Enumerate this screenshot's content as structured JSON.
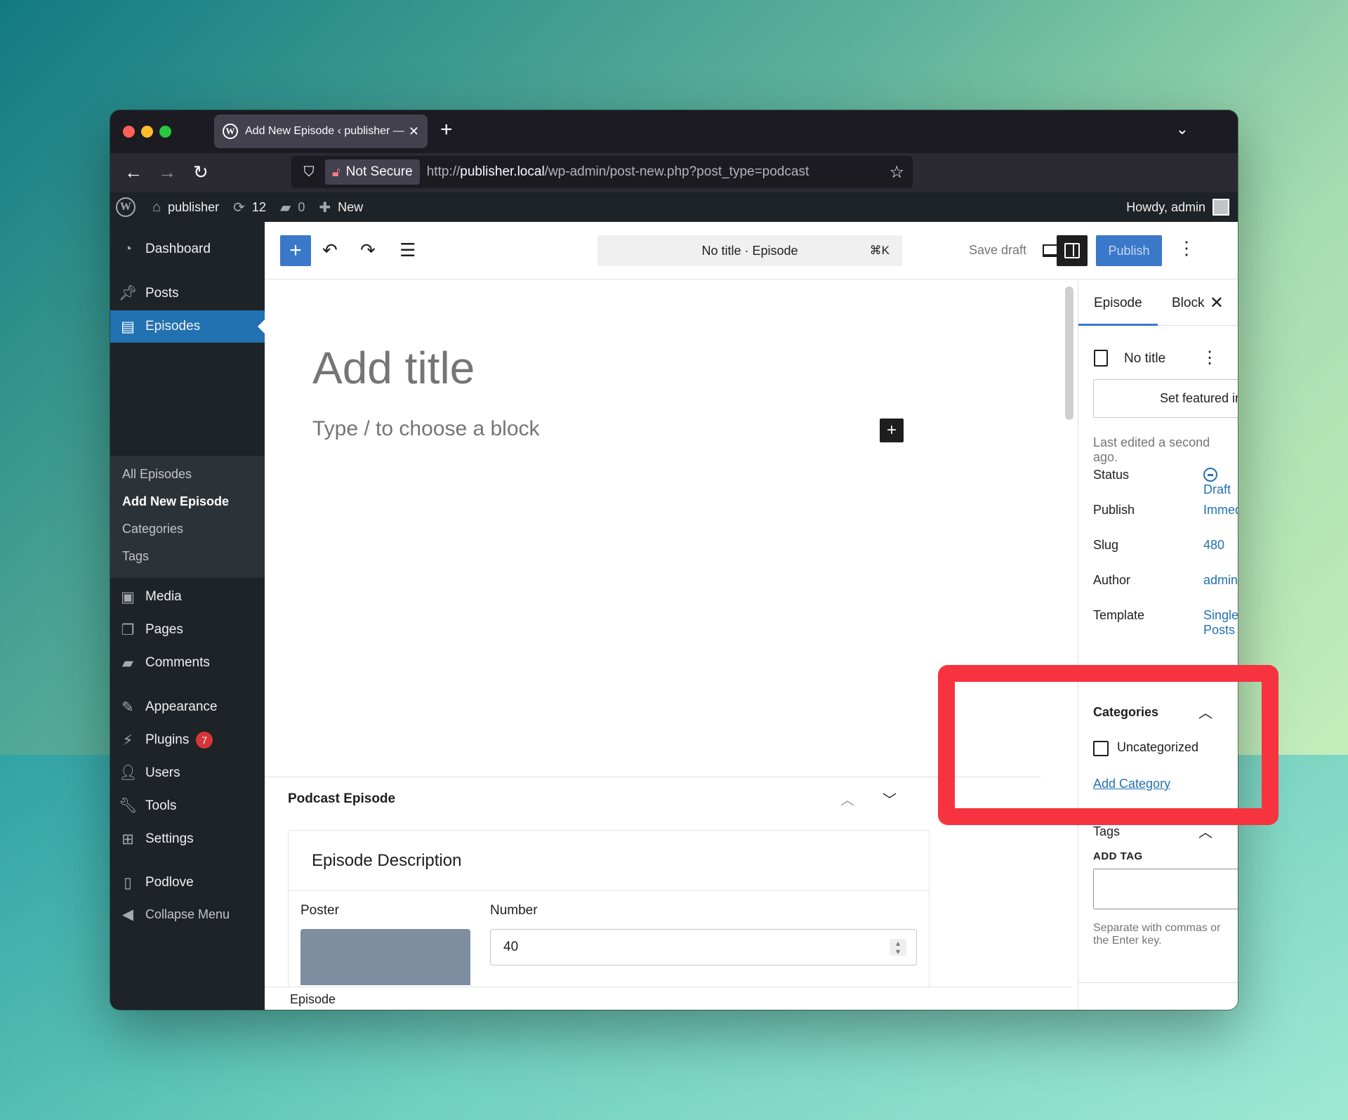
{
  "browser": {
    "tab_title": "Add New Episode ‹ publisher —",
    "tab_favicon": "wordpress-icon",
    "new_tab": "+",
    "security_label": "Not Secure",
    "url_prefix": "http://",
    "url_host": "publisher.local",
    "url_path": "/wp-admin/post-new.php?post_type=podcast"
  },
  "adminbar": {
    "site_name": "publisher",
    "updates_count": "12",
    "comments_count": "0",
    "new_label": "New",
    "howdy": "Howdy, admin"
  },
  "sidebar": {
    "dashboard": "Dashboard",
    "posts": "Posts",
    "episodes": "Episodes",
    "sub_all": "All Episodes",
    "sub_add": "Add New Episode",
    "sub_categories": "Categories",
    "sub_tags": "Tags",
    "media": "Media",
    "pages": "Pages",
    "comments": "Comments",
    "appearance": "Appearance",
    "plugins": "Plugins",
    "plugins_badge": "7",
    "users": "Users",
    "tools": "Tools",
    "settings": "Settings",
    "podlove": "Podlove",
    "collapse": "Collapse Menu"
  },
  "toolbar": {
    "command_title": "No title · Episode",
    "command_shortcut": "⌘K",
    "save_draft": "Save draft",
    "publish": "Publish"
  },
  "canvas": {
    "title_placeholder": "Add title",
    "block_placeholder": "Type / to choose a block"
  },
  "metabox": {
    "title": "Podcast Episode",
    "panel_title": "Episode Description",
    "poster_label": "Poster",
    "number_label": "Number",
    "number_value": "40"
  },
  "footer": {
    "breadcrumb": "Episode"
  },
  "settings_sidebar": {
    "tab_episode": "Episode",
    "tab_block": "Block",
    "post_title": "No title",
    "featured_image_button": "Set featured image",
    "last_edited": "Last edited a second ago.",
    "rows": [
      {
        "label": "Status",
        "value": "Draft"
      },
      {
        "label": "Publish",
        "value": "Immediately"
      },
      {
        "label": "Slug",
        "value": "480"
      },
      {
        "label": "Author",
        "value": "admin"
      },
      {
        "label": "Template",
        "value": "Single Posts"
      }
    ],
    "categories_title": "Categories",
    "category_option": "Uncategorized",
    "category_checked": false,
    "add_category": "Add Category",
    "tags_title": "Tags",
    "add_tag_label": "ADD TAG",
    "tag_help": "Separate with commas or the Enter key."
  },
  "colors": {
    "wp_blue": "#2271b1",
    "admin_dark": "#1d2327",
    "highlight_red": "#f6333f"
  }
}
